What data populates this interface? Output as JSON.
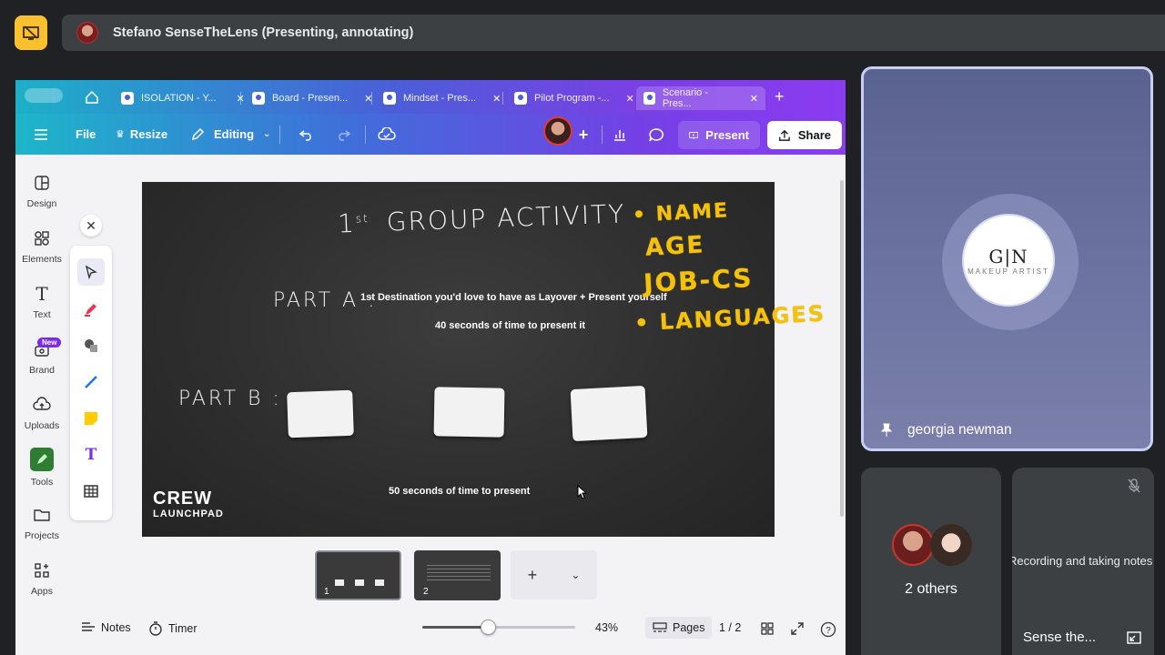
{
  "presenting": {
    "label": "Stefano SenseTheLens (Presenting, annotating)"
  },
  "canva": {
    "tabs": [
      {
        "label": "ISOLATION - Y..."
      },
      {
        "label": "Board - Presen..."
      },
      {
        "label": "Mindset - Pres..."
      },
      {
        "label": "Pilot Program -..."
      },
      {
        "label": "Scenario - Pres..."
      }
    ],
    "toolbar": {
      "file": "File",
      "resize": "Resize",
      "editing": "Editing",
      "present": "Present",
      "share": "Share"
    },
    "sidebar": [
      {
        "label": "Design"
      },
      {
        "label": "Elements"
      },
      {
        "label": "Text"
      },
      {
        "label": "Brand",
        "badge": "New"
      },
      {
        "label": "Uploads"
      },
      {
        "label": "Tools"
      },
      {
        "label": "Projects"
      },
      {
        "label": "Apps"
      }
    ],
    "slide": {
      "title": "1",
      "title_sup": "st",
      "title_rest": "GROUP ACTIVITY",
      "part_a": "PART A :",
      "part_a_text": "1st Destination you'd love to have as Layover + Present yourself",
      "part_a_time": "40 seconds of time to present it",
      "part_b": "PART B :",
      "part_b_time": "50 seconds of time to present",
      "logo_line1": "CREW",
      "logo_line2": "LAUNCHPAD",
      "annotations": [
        "• NAME",
        "AGE",
        "JOB-CS",
        "• LANGUAGES"
      ]
    },
    "pages": [
      {
        "number": "1"
      },
      {
        "number": "2"
      }
    ],
    "bottom": {
      "notes": "Notes",
      "timer": "Timer",
      "zoom": "43%",
      "zoom_level": 0.43,
      "pages": "Pages",
      "page_count": "1 / 2"
    }
  },
  "meet": {
    "main_tile": {
      "name": "georgia newman",
      "logo_text": "G|N",
      "logo_sub": "MAKEUP ARTIST"
    },
    "others_tile": {
      "label": "2 others"
    },
    "notes_tile": {
      "status": "Recording and taking notes",
      "name": "Sense the..."
    }
  }
}
